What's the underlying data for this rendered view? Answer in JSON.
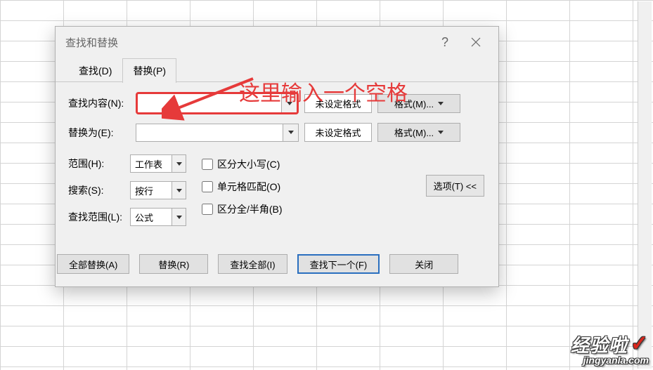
{
  "dialog": {
    "title": "查找和替换",
    "tabs": {
      "find": "查找(D)",
      "replace": "替换(P)"
    },
    "find_row": {
      "label": "查找内容(N):",
      "value": "",
      "fmt_none": "未设定格式",
      "fmt_btn": "格式(M)..."
    },
    "replace_row": {
      "label": "替换为(E):",
      "value": "",
      "fmt_none": "未设定格式",
      "fmt_btn": "格式(M)..."
    },
    "opts": {
      "scope": {
        "label": "范围(H):",
        "value": "工作表"
      },
      "search": {
        "label": "搜索(S):",
        "value": "按行"
      },
      "lookin": {
        "label": "查找范围(L):",
        "value": "公式"
      },
      "matchcase": "区分大小写(C)",
      "wholecell": "单元格匹配(O)",
      "width": "区分全/半角(B)"
    },
    "options_btn": "选项(T) <<",
    "buttons": {
      "replace_all": "全部替换(A)",
      "replace": "替换(R)",
      "find_all": "查找全部(I)",
      "find_next": "查找下一个(F)",
      "close": "关闭"
    }
  },
  "annotation": "这里输入一个空格",
  "watermark": {
    "line1": "经验啦",
    "line2": "jingyanla.com"
  }
}
